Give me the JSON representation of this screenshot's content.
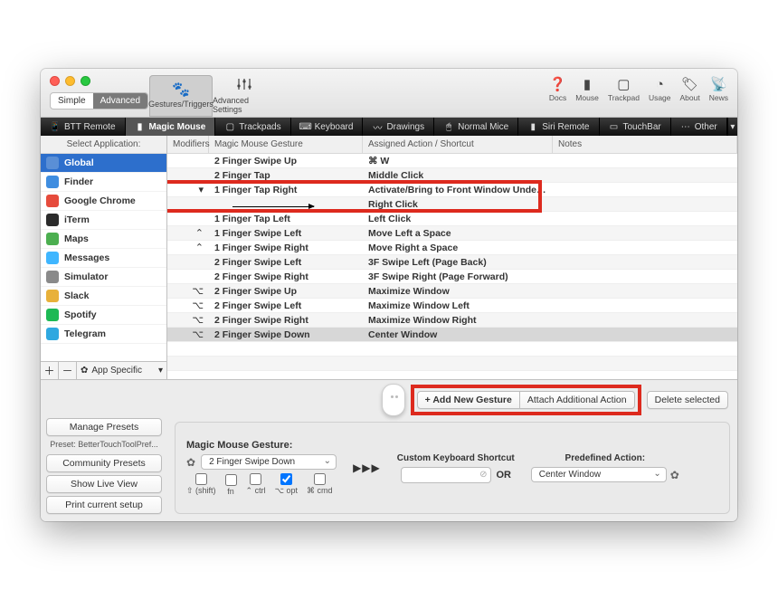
{
  "modeToggle": {
    "simple": "Simple",
    "advanced": "Advanced"
  },
  "toolbarTabs": {
    "gestures": "Gestures/Triggers",
    "advanced": "Advanced Settings"
  },
  "rightIcons": {
    "docs": "Docs",
    "mouse": "Mouse",
    "trackpad": "Trackpad",
    "usage": "Usage",
    "about": "About",
    "news": "News"
  },
  "deviceTabs": {
    "bttRemote": "BTT Remote",
    "magicMouse": "Magic Mouse",
    "trackpads": "Trackpads",
    "keyboard": "Keyboard",
    "drawings": "Drawings",
    "normalMice": "Normal Mice",
    "siriRemote": "Siri Remote",
    "touchBar": "TouchBar",
    "other": "Other"
  },
  "sidebar": {
    "header": "Select Application:",
    "items": [
      {
        "label": "Global",
        "iconColor": "#5a8fd6",
        "selected": true
      },
      {
        "label": "Finder",
        "iconColor": "#3f8de0"
      },
      {
        "label": "Google Chrome",
        "iconColor": "#e64b3c"
      },
      {
        "label": "iTerm",
        "iconColor": "#2b2b2b"
      },
      {
        "label": "Maps",
        "iconColor": "#4caf50"
      },
      {
        "label": "Messages",
        "iconColor": "#3fb6ff"
      },
      {
        "label": "Simulator",
        "iconColor": "#8a8a8a"
      },
      {
        "label": "Slack",
        "iconColor": "#e8b13a"
      },
      {
        "label": "Spotify",
        "iconColor": "#1db954"
      },
      {
        "label": "Telegram",
        "iconColor": "#2fa8e0"
      }
    ],
    "appSpecific": "App Specific"
  },
  "table": {
    "headers": {
      "modifiers": "Modifiers",
      "gesture": "Magic Mouse Gesture",
      "action": "Assigned Action / Shortcut",
      "notes": "Notes"
    },
    "rows": [
      {
        "mod": "",
        "gesture": "2 Finger Swipe Up",
        "action": "⌘ W"
      },
      {
        "mod": "",
        "gesture": "2 Finger Tap",
        "action": "Middle Click"
      },
      {
        "mod": "▾",
        "gesture": "1 Finger Tap Right",
        "action": "Activate/Bring to Front Window Under Cursor",
        "highlight": true
      },
      {
        "mod": "",
        "gesture": "__arrow__",
        "action": "Right Click",
        "highlight": true
      },
      {
        "mod": "",
        "gesture": "1 Finger Tap Left",
        "action": "Left Click"
      },
      {
        "mod": "⌃",
        "gesture": "1 Finger Swipe Left",
        "action": "Move Left a Space"
      },
      {
        "mod": "⌃",
        "gesture": "1 Finger Swipe Right",
        "action": "Move Right a Space"
      },
      {
        "mod": "",
        "gesture": "2 Finger Swipe Left",
        "action": "3F Swipe Left (Page Back)"
      },
      {
        "mod": "",
        "gesture": "2 Finger Swipe Right",
        "action": "3F Swipe Right (Page Forward)"
      },
      {
        "mod": "⌥",
        "gesture": "2 Finger Swipe Up",
        "action": "Maximize Window"
      },
      {
        "mod": "⌥",
        "gesture": "2 Finger Swipe Left",
        "action": "Maximize Window Left"
      },
      {
        "mod": "⌥",
        "gesture": "2 Finger Swipe Right",
        "action": "Maximize Window Right"
      },
      {
        "mod": "⌥",
        "gesture": "2 Finger Swipe Down",
        "action": "Center Window",
        "selected": true
      }
    ]
  },
  "footer": {
    "addNew": "+ Add New Gesture",
    "attach": "Attach Additional Action",
    "deleteSel": "Delete selected",
    "managePresets": "Manage Presets",
    "presetLabel": "Preset: BetterTouchToolPref...",
    "communityPresets": "Community Presets",
    "showLiveView": "Show Live View",
    "printSetup": "Print current setup",
    "gestureTitle": "Magic Mouse Gesture:",
    "gestureValue": "2 Finger Swipe Down",
    "modLabels": {
      "shift": "⇧ (shift)",
      "fn": "fn",
      "ctrl": "⌃ ctrl",
      "opt": "⌥ opt",
      "cmd": "⌘ cmd"
    },
    "shortcutTitle": "Custom Keyboard Shortcut",
    "or": "OR",
    "predefTitle": "Predefined Action:",
    "predefValue": "Center Window"
  }
}
